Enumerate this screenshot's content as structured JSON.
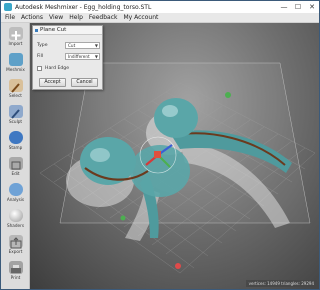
{
  "window": {
    "title": "Autodesk Meshmixer - Egg_holding_torso.STL",
    "controls": [
      "—",
      "☐",
      "✕"
    ]
  },
  "menu": [
    "File",
    "Actions",
    "View",
    "Help",
    "Feedback",
    "My Account"
  ],
  "toolbar": [
    {
      "label": "Import",
      "icon": "plus-icon",
      "color": "#b5b5b5"
    },
    {
      "label": "Meshmix",
      "icon": "meshmix-icon",
      "color": "#5ea0c8"
    },
    {
      "label": "Select",
      "icon": "select-brush-icon",
      "color": "#c89a4a"
    },
    {
      "label": "Sculpt",
      "icon": "sculpt-brush-icon",
      "color": "#5c7fb0"
    },
    {
      "label": "Stamp",
      "icon": "stamp-icon",
      "color": "#3f78c2"
    },
    {
      "label": "Edit",
      "icon": "edit-icon",
      "color": "#909090"
    },
    {
      "label": "Analysis",
      "icon": "analysis-icon",
      "color": "#6fa2d6"
    },
    {
      "label": "Shaders",
      "icon": "shaders-icon",
      "color": "#ededed"
    },
    {
      "label": "Export",
      "icon": "export-icon",
      "color": "#8f8f8f"
    },
    {
      "label": "Print",
      "icon": "print-icon",
      "color": "#7c7c7c"
    }
  ],
  "panel": {
    "title": "Plane Cut",
    "type_label": "Type",
    "type_value": "Cut",
    "fill_label": "Fill",
    "fill_value": "Indifferent",
    "hard_edge_label": "Hard Edge",
    "accept_label": "Accept",
    "cancel_label": "Cancel"
  },
  "status": "vertices: 14949 triangles: 29294",
  "colors": {
    "model": "#5aa6a8",
    "model_inner": "#6b3a1e",
    "gizmo_x": "#d63a3a",
    "gizmo_y": "#4caf50",
    "gizmo_z": "#3a5fd6"
  }
}
